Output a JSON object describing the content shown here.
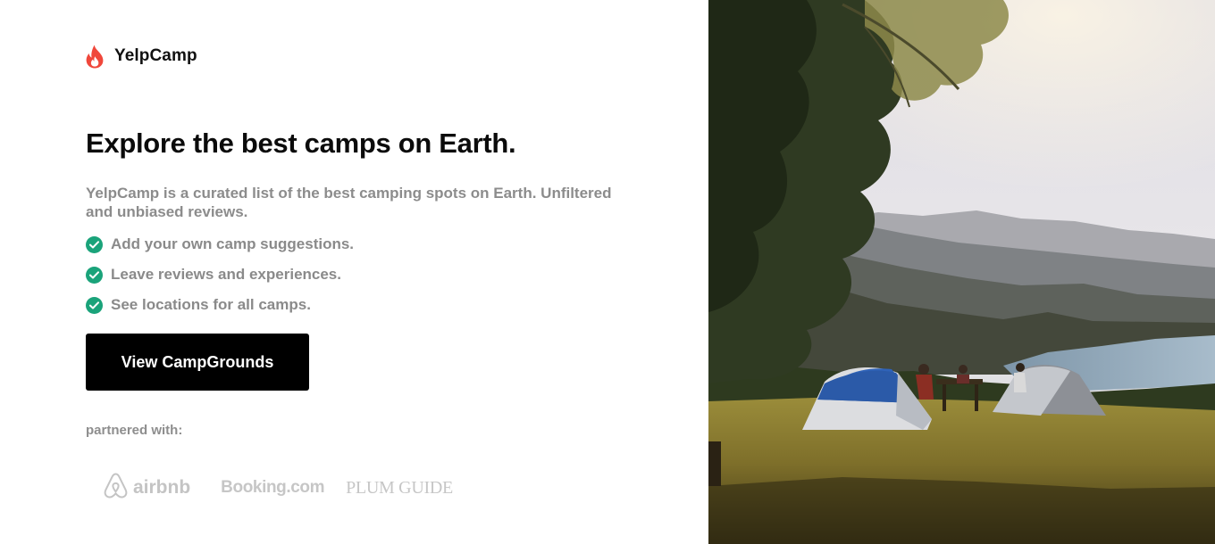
{
  "brand": {
    "name": "YelpCamp",
    "icon": "flame-icon",
    "color": "#f0473b"
  },
  "hero": {
    "headline": "Explore the best camps on Earth.",
    "description": "YelpCamp is a curated list of the best camping spots on Earth. Unfiltered and unbiased reviews."
  },
  "features": [
    {
      "icon": "check-circle-icon",
      "text": "Add your own camp suggestions."
    },
    {
      "icon": "check-circle-icon",
      "text": "Leave reviews and experiences."
    },
    {
      "icon": "check-circle-icon",
      "text": "See locations for all camps."
    }
  ],
  "cta": {
    "label": "View CampGrounds"
  },
  "partners": {
    "heading": "partnered with:",
    "logos": [
      "airbnb",
      "Booking.com",
      "PLUM GUIDE"
    ]
  },
  "colors": {
    "accent": "#1aa37a",
    "button": "#000000",
    "muted_text": "#8c8c8c"
  }
}
